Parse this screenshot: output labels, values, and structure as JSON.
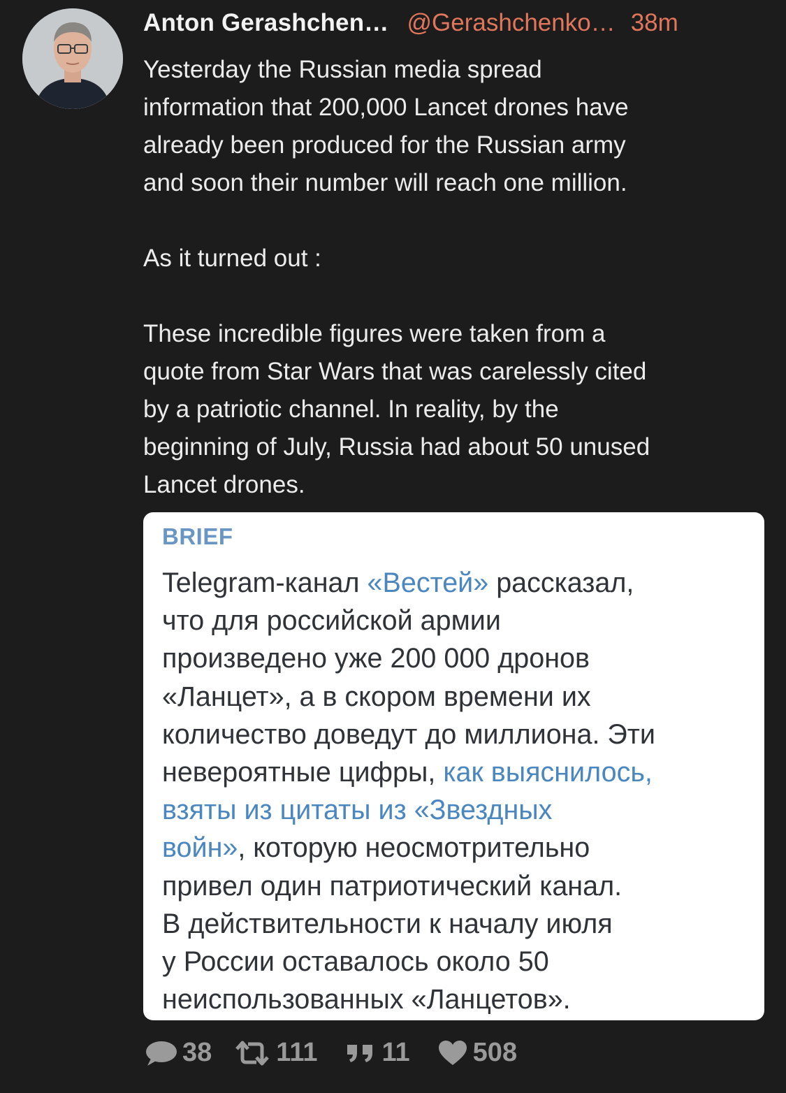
{
  "tweet": {
    "author": {
      "display_name": "Anton Gerashchen…",
      "handle": "@Gerashchenko…",
      "time_ago": "38m"
    },
    "text_lines": [
      "Yesterday the Russian media spread",
      "information that 200,000 Lancet drones have",
      "already been produced for the Russian army",
      "and soon their number will reach one million.",
      "",
      "As it turned out :",
      "",
      "These incredible figures were taken from a",
      "quote from Star Wars that was carelessly cited",
      "by a patriotic channel. In reality, by the",
      "beginning of July, Russia had about 50 unused",
      "Lancet drones."
    ],
    "attachment": {
      "label": "BRIEF",
      "lines": [
        [
          {
            "text": "Telegram-канал "
          },
          {
            "text": "«Вестей»",
            "link": true
          },
          {
            "text": " рассказал,"
          }
        ],
        [
          {
            "text": "что для российской армии"
          }
        ],
        [
          {
            "text": "произведено уже 200 000 дронов"
          }
        ],
        [
          {
            "text": "«Ланцет», а в скором времени их"
          }
        ],
        [
          {
            "text": "количество доведут до миллиона. Эти"
          }
        ],
        [
          {
            "text": "невероятные цифры, "
          },
          {
            "text": "как выяснилось,",
            "link": true
          }
        ],
        [
          {
            "text": "взяты из цитаты из «Звездных",
            "link": true
          }
        ],
        [
          {
            "text": "войн»",
            "link": true
          },
          {
            "text": ", которую неосмотрительно"
          }
        ],
        [
          {
            "text": "привел один патриотический канал."
          }
        ],
        [
          {
            "text": "В действительности к началу июля"
          }
        ],
        [
          {
            "text": "у России оставалось около 50"
          }
        ],
        [
          {
            "text": "неиспользованных «Ланцетов»."
          }
        ]
      ]
    },
    "actions": {
      "replies": "38",
      "retweets": "111",
      "quotes": "11",
      "likes": "508"
    },
    "icons": {
      "reply": "speech-bubble-icon",
      "retweet": "retweet-icon",
      "quote": "quote-icon",
      "like": "heart-icon"
    },
    "colors": {
      "background": "#1c1c1c",
      "handle": "#e0765b",
      "link": "#4a86c0",
      "muted": "#9a9a9a"
    }
  }
}
